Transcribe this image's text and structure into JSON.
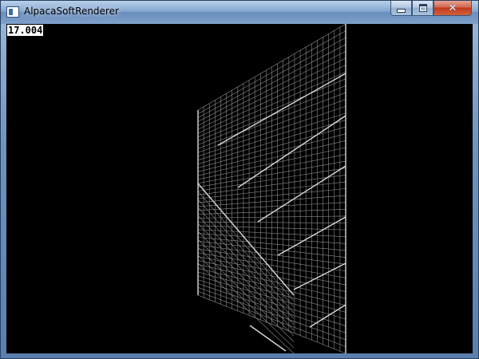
{
  "window": {
    "title": "AlpacaSoftRenderer",
    "buttons": {
      "minimize_icon": "minimize-icon",
      "maximize_icon": "maximize-icon",
      "close_icon": "close-icon",
      "close_glyph": "✕"
    }
  },
  "viewport": {
    "fps": "17.004",
    "background": "#000000",
    "wire_color": "#bfbfbf"
  }
}
